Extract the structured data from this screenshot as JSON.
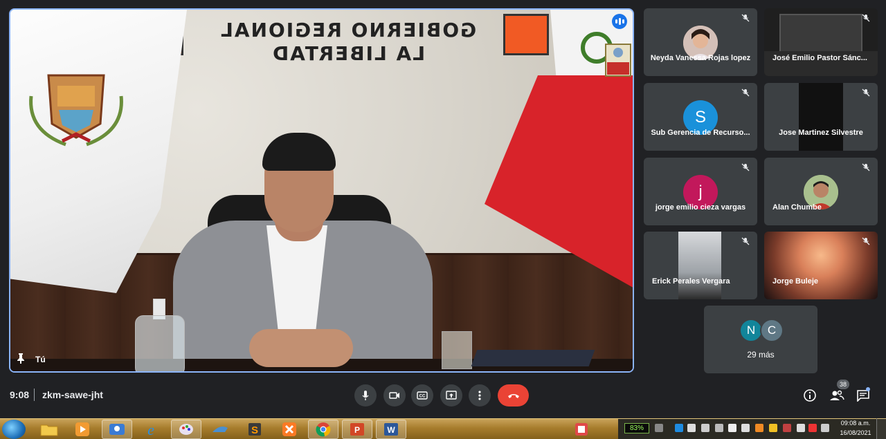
{
  "main_video": {
    "speaker_label": "Tú",
    "sign_text": [
      "GOBIERNO REGIONAL",
      "LA LIBERTAD"
    ]
  },
  "participants": [
    {
      "name": "Neyda Vanessa Rojas lopez",
      "type": "photo",
      "muted": true
    },
    {
      "name": "José Emilio Pastor Sánc...",
      "type": "video",
      "muted": true
    },
    {
      "name": "Sub Gerencia de Recurso...",
      "type": "initial",
      "initial": "S",
      "color": "#1a91da",
      "muted": true
    },
    {
      "name": "Jose Martinez Silvestre",
      "type": "video",
      "muted": true
    },
    {
      "name": "jorge emilio cieza vargas",
      "type": "initial",
      "initial": "j",
      "color": "#c2185b",
      "muted": true
    },
    {
      "name": "Alan Chumbe",
      "type": "photo",
      "muted": true
    },
    {
      "name": "Erick Perales Vergara",
      "type": "video",
      "muted": true
    },
    {
      "name": "Jorge Buleje",
      "type": "video",
      "muted": true
    }
  ],
  "more": {
    "initials": [
      "N",
      "C"
    ],
    "colors": [
      "#12859a",
      "#5f7885"
    ],
    "label": "29 más"
  },
  "bottom_bar": {
    "time": "9:08",
    "meeting_code": "zkm-sawe-jht",
    "participant_count": "38"
  },
  "taskbar": {
    "battery": "83%",
    "clock_time": "09:08 a.m.",
    "clock_date": "16/08/2021"
  }
}
